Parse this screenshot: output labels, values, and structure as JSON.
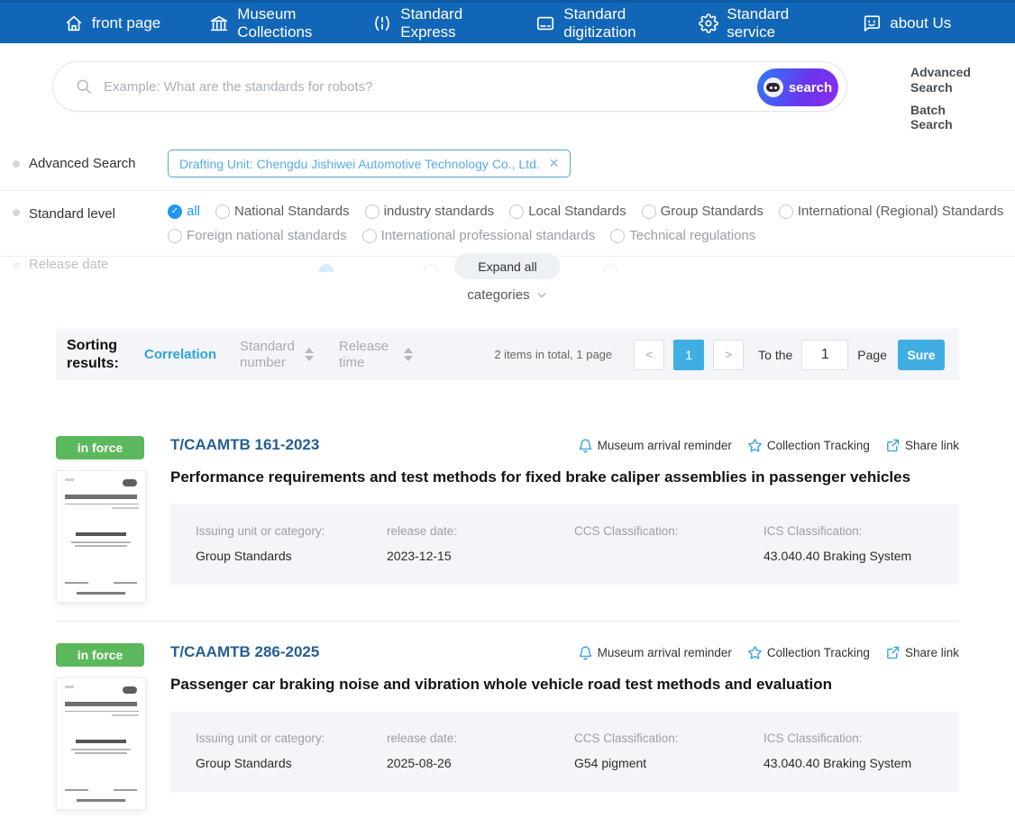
{
  "nav": {
    "items": [
      {
        "label": "front page",
        "icon": "home-icon"
      },
      {
        "label": "Museum Collections",
        "icon": "museum-icon"
      },
      {
        "label": "Standard Express",
        "icon": "express-icon"
      },
      {
        "label": "Standard digitization",
        "icon": "digitization-icon"
      },
      {
        "label": "Standard service",
        "icon": "service-icon"
      },
      {
        "label": "about Us",
        "icon": "about-icon"
      }
    ]
  },
  "search": {
    "placeholder": "Example: What are the standards for robots?",
    "button_label": "search",
    "advanced_link": "Advanced Search",
    "batch_link": "Batch Search"
  },
  "filters": {
    "advanced_label": "Advanced Search",
    "drafting_tag": "Drafting Unit: Chengdu Jishiwei Automotive Technology Co., Ltd.",
    "close_glyph": "✕",
    "standard_level_label": "Standard level",
    "levels_row1": [
      "all",
      "National Standards",
      "industry standards",
      "Local Standards",
      "Group Standards",
      "International (Regional) Standards"
    ],
    "levels_row2": [
      "Foreign national standards",
      "International professional standards",
      "Technical regulations"
    ],
    "selected_level": "all",
    "check_glyph": "✓",
    "collapsed_label": "Release date",
    "expand_all": "Expand all",
    "categories": "categories"
  },
  "sorting": {
    "label": "Sorting results:",
    "active_option": "Correlation",
    "option_number": "Standard number",
    "option_time": "Release time",
    "total_text": "2 items in total, 1 page",
    "prev": "<",
    "next": ">",
    "current_page": "1",
    "to_the": "To the",
    "page_input": "1",
    "page_label": "Page",
    "sure": "Sure"
  },
  "actions": {
    "reminder": "Museum arrival reminder",
    "tracking": "Collection Tracking",
    "share": "Share link"
  },
  "panel_labels": {
    "issuing": "Issuing unit or category:",
    "release": "release date:",
    "ccs": "CCS Classification:",
    "ics": "ICS Classification:"
  },
  "results": [
    {
      "status": "in force",
      "code": "T/CAAMTB 161-2023",
      "title": "Performance requirements and test methods for fixed brake caliper assemblies in passenger vehicles",
      "issuing": "Group Standards",
      "release": "2023-12-15",
      "ccs": "",
      "ics": "43.040.40 Braking System"
    },
    {
      "status": "in force",
      "code": "T/CAAMTB 286-2025",
      "title": "Passenger car braking noise and vibration whole vehicle road test methods and evaluation",
      "issuing": "Group Standards",
      "release": "2025-08-26",
      "ccs": "G54 pigment",
      "ics": "43.040.40 Braking System"
    }
  ],
  "colors": {
    "nav_blue": "#1266b8",
    "accent_blue": "#2196f3",
    "page_blue": "#41aee3",
    "badge_green": "#5cb85c",
    "code_blue": "#255e94",
    "tag_blue": "#53a4e0",
    "button_gradient_start": "#2f7cf6",
    "button_gradient_end": "#8b2bf0"
  }
}
